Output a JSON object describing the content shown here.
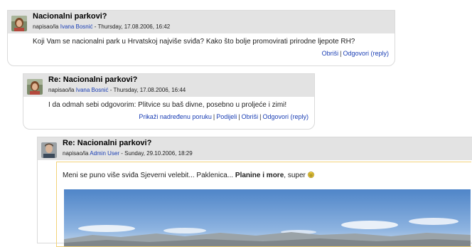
{
  "posts": [
    {
      "subject": "Nacionalni parkovi?",
      "written_by": "napisao/la",
      "author": "Ivana Bosnić",
      "date": "- Thursday, 17.08.2006, 16:42",
      "message": "Koji Vam se nacionalni park u Hrvatskoj najviše sviđa? Kako što bolje promovirati prirodne ljepote RH?",
      "commands": [
        "Obriši",
        "Odgovori (reply)"
      ]
    },
    {
      "subject": "Re: Nacionalni parkovi?",
      "written_by": "napisao/la",
      "author": "Ivana Bosnić",
      "date": "- Thursday, 17.08.2006, 16:44",
      "message": "I da odmah sebi odgovorim: Plitvice su baš divne, posebno u proljeće i zimi!",
      "commands": [
        "Prikaži nadređenu poruku",
        "Podijeli",
        "Obriši",
        "Odgovori (reply)"
      ]
    },
    {
      "subject": "Re: Nacionalni parkovi?",
      "written_by": "napisao/la",
      "author": "Admin User",
      "date": "- Sunday, 29.10.2006, 18:29",
      "message_start": "Meni se puno više sviđa Sjeverni velebit... Paklenica...",
      "message_bold": "Planine i more",
      "message_end": ", super"
    }
  ],
  "colors": {
    "header_bg": "#e3e3e3",
    "link": "#1a3eb4",
    "highlight_border": "#f3d37a"
  },
  "icons": [
    "woman-avatar-icon",
    "man-avatar-icon",
    "smiley-icon"
  ]
}
